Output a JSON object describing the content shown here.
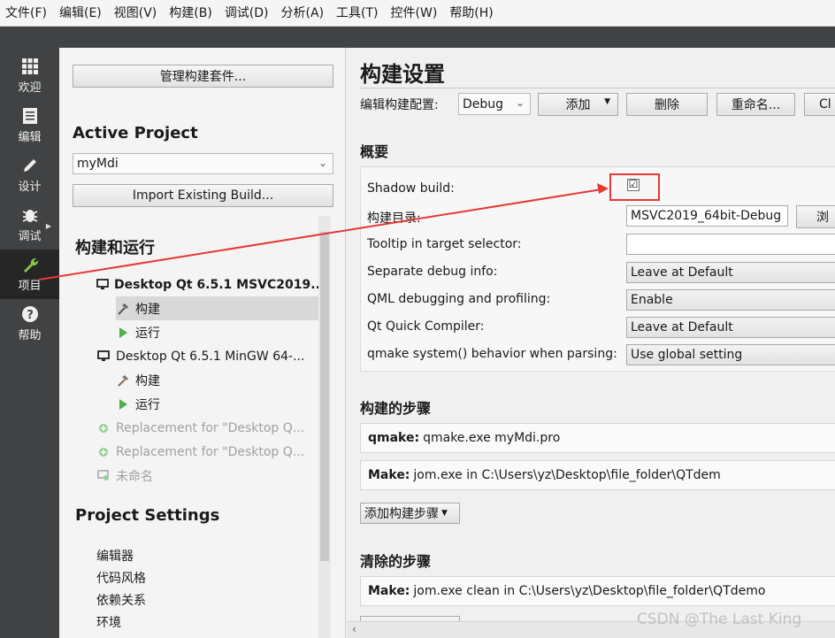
{
  "menu": [
    "文件(F)",
    "编辑(E)",
    "视图(V)",
    "构建(B)",
    "调试(D)",
    "分析(A)",
    "工具(T)",
    "控件(W)",
    "帮助(H)"
  ],
  "modes": [
    {
      "label": "欢迎",
      "icon": "grid-icon"
    },
    {
      "label": "编辑",
      "icon": "document-icon"
    },
    {
      "label": "设计",
      "icon": "pencil-icon"
    },
    {
      "label": "调试",
      "icon": "bug-icon"
    },
    {
      "label": "项目",
      "icon": "wrench-icon"
    },
    {
      "label": "帮助",
      "icon": "help-icon"
    }
  ],
  "nav": {
    "manage_kits_button": "管理构建套件...",
    "active_project_heading": "Active Project",
    "project_combo": "myMdi",
    "import_build_button": "Import Existing Build...",
    "build_run_heading": "构建和运行",
    "tree": [
      {
        "label": "Desktop Qt 6.5.1 MSVC2019...",
        "icon": "monitor-icon",
        "bold": true
      },
      {
        "label": "构建",
        "icon": "hammer-icon",
        "selected": true
      },
      {
        "label": "运行",
        "icon": "run-icon"
      },
      {
        "label": "Desktop Qt 6.5.1 MinGW 64-...",
        "icon": "monitor-icon"
      },
      {
        "label": "构建",
        "icon": "hammer-icon"
      },
      {
        "label": "运行",
        "icon": "run-icon"
      },
      {
        "label": "Replacement for \"Desktop Q...",
        "icon": "plus-circle-icon",
        "dim": true
      },
      {
        "label": "Replacement for \"Desktop Q...",
        "icon": "plus-circle-icon",
        "dim": true
      },
      {
        "label": "未命名",
        "icon": "monitor-add-icon",
        "dim": true
      }
    ],
    "project_settings_heading": "Project Settings",
    "settings_items": [
      "编辑器",
      "代码风格",
      "依赖关系",
      "环境"
    ]
  },
  "main": {
    "title": "构建设置",
    "config_label": "编辑构建配置:",
    "config_value": "Debug",
    "add_button": "添加",
    "delete_button": "删除",
    "rename_button": "重命名...",
    "clone_button": "Cl",
    "overview_heading": "概要",
    "shadow_build_label": "Shadow build:",
    "shadow_build_check": "☑",
    "build_dir_label": "构建目录:",
    "build_dir_value": "MSVC2019_64bit-Debug",
    "browse_button": "浏",
    "tooltip_label": "Tooltip in target selector:",
    "tooltip_value": "",
    "separate_debug_label": "Separate debug info:",
    "separate_debug_value": "Leave at Default",
    "qml_debug_label": "QML debugging and profiling:",
    "qml_debug_value": "Enable",
    "quick_compiler_label": "Qt Quick Compiler:",
    "quick_compiler_value": "Leave at Default",
    "qmake_behavior_label": "qmake system() behavior when parsing:",
    "qmake_behavior_value": "Use global setting",
    "build_steps_heading": "构建的步骤",
    "steps": [
      {
        "name": "qmake:",
        "detail": "qmake.exe myMdi.pro"
      },
      {
        "name": "Make:",
        "detail": "jom.exe in C:\\Users\\yz\\Desktop\\file_folder\\QTdem"
      }
    ],
    "add_step_button": "添加构建步骤",
    "clean_steps_heading": "清除的步骤",
    "clean_steps": [
      {
        "name": "Make:",
        "detail": "jom.exe clean in C:\\Users\\yz\\Desktop\\file_folder\\QTdemo"
      }
    ]
  },
  "watermark": "CSDN @The  Last  King",
  "colors": {
    "sidebar": "#404244",
    "sidebar_active": "#262626",
    "annotation": "#e53935"
  }
}
